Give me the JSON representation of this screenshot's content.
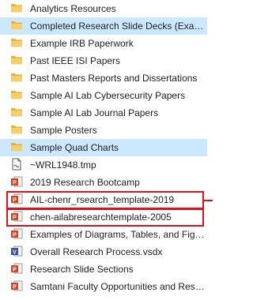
{
  "accent_colors": {
    "selection": "#cce8ff",
    "highlight": "#e0101c",
    "folder": "#e8b33c"
  },
  "items": [
    {
      "label": "Analytics Resources",
      "icon": "folder-icon",
      "selected": false
    },
    {
      "label": "Completed Research Slide Decks (Examp...",
      "icon": "folder-icon",
      "selected": true
    },
    {
      "label": "Example IRB Paperwork",
      "icon": "folder-icon",
      "selected": false
    },
    {
      "label": "Past IEEE ISI Papers",
      "icon": "folder-icon",
      "selected": false
    },
    {
      "label": "Past Masters Reports and Dissertations",
      "icon": "folder-icon",
      "selected": false
    },
    {
      "label": "Sample AI Lab Cybersecurity Papers",
      "icon": "folder-icon",
      "selected": false
    },
    {
      "label": "Sample AI Lab Journal Papers",
      "icon": "folder-icon",
      "selected": false
    },
    {
      "label": "Sample Posters",
      "icon": "folder-icon",
      "selected": false
    },
    {
      "label": "Sample Quad Charts",
      "icon": "folder-icon",
      "selected": true
    },
    {
      "label": "~WRL1948.tmp",
      "icon": "tmp-file-icon",
      "selected": false
    },
    {
      "label": "2019 Research Bootcamp",
      "icon": "powerpoint-file-icon",
      "selected": false
    },
    {
      "label": "AIL-chenr_rsearch_template-2019",
      "icon": "powerpoint-file-icon",
      "selected": false,
      "highlighted": true
    },
    {
      "label": "chen-ailabresearchtemplate-2005",
      "icon": "powerpoint-file-icon",
      "selected": false,
      "highlighted": true
    },
    {
      "label": "Examples of Diagrams, Tables, and Figures",
      "icon": "powerpoint-file-icon",
      "selected": false
    },
    {
      "label": "Overall Research Process.vsdx",
      "icon": "visio-file-icon",
      "selected": false
    },
    {
      "label": "Research Slide Sections",
      "icon": "powerpoint-file-icon",
      "selected": false
    },
    {
      "label": "Samtani Faculty Opportunities and Resou...",
      "icon": "powerpoint-file-icon",
      "selected": false
    }
  ]
}
